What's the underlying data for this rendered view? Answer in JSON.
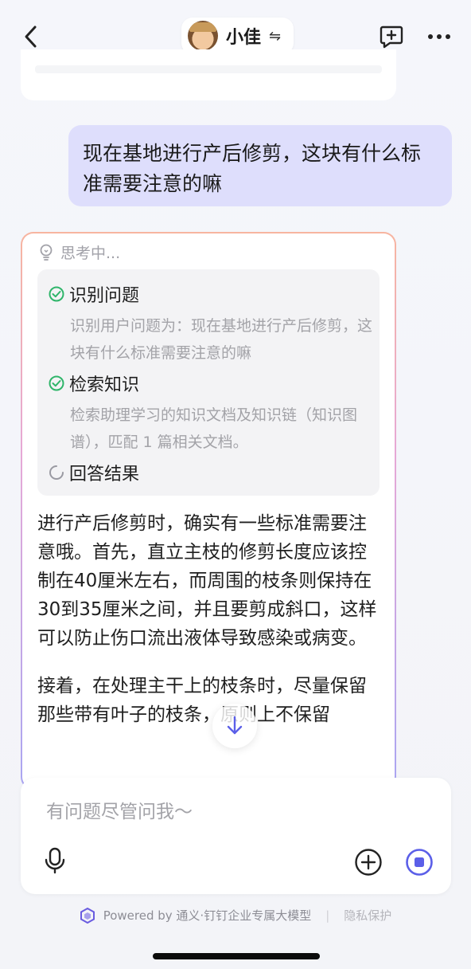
{
  "header": {
    "title": "小佳",
    "swap_symbol": "⇋",
    "icons": [
      "back-chevron-icon",
      "new-chat-icon",
      "more-icon"
    ]
  },
  "user_message": "现在基地进行产后修剪，这块有什么标准需要注意的嘛",
  "answer": {
    "thinking_label": "思考中...",
    "steps": [
      {
        "title": "识别问题",
        "desc": "识别用户问题为：现在基地进行产后修剪，这块有什么标准需要注意的嘛",
        "status": "done"
      },
      {
        "title": "检索知识",
        "desc": "检索助理学习的知识文档及知识链（知识图谱），匹配 1 篇相关文档。",
        "status": "done"
      },
      {
        "title": "回答结果",
        "desc": "",
        "status": "loading"
      }
    ],
    "paragraphs": [
      "进行产后修剪时，确实有一些标准需要注意哦。首先，直立主枝的修剪长度应该控制在40厘米左右，而周围的枝条则保持在30到35厘米之间，并且要剪成斜口，这样可以防止伤口流出液体导致感染或病变。",
      "接着，在处理主干上的枝条时，尽量保留那些带有叶子的枝条，原则上不保留"
    ]
  },
  "input": {
    "placeholder": "有问题尽管问我～"
  },
  "footer": {
    "powered_by": "Powered by 通义·钉钉企业专属大模型",
    "separator": "|",
    "privacy": "隐私保护"
  },
  "colors": {
    "accent": "#5b5fe8",
    "check_green": "#2fb56a",
    "user_bubble": "#dedefc"
  }
}
